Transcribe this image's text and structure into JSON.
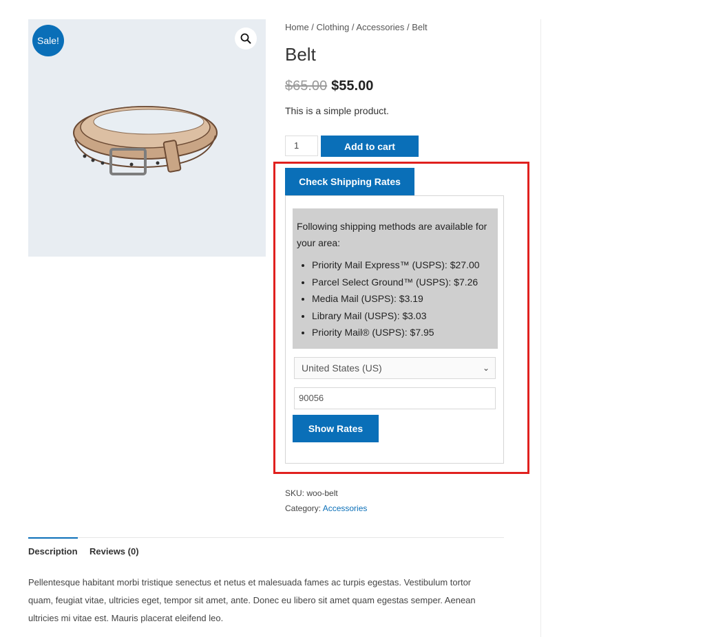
{
  "gallery": {
    "sale_badge": "Sale!",
    "zoom_icon": "search-icon",
    "image_alt": "belt"
  },
  "breadcrumb": "Home / Clothing / Accessories / Belt",
  "product": {
    "title": "Belt",
    "old_price": "$65.00",
    "new_price": "$55.00",
    "short_description": "This is a simple product.",
    "quantity": "1",
    "add_to_cart_label": "Add to cart"
  },
  "shipping": {
    "check_button": "Check Shipping Rates",
    "intro": "Following shipping methods are available for your area:",
    "methods": [
      "Priority Mail Express™ (USPS): $27.00",
      "Parcel Select Ground™ (USPS): $7.26",
      "Media Mail (USPS): $3.19",
      "Library Mail (USPS): $3.03",
      "Priority Mail® (USPS): $7.95"
    ],
    "country_value": "United States (US)",
    "zip_value": "90056",
    "show_rates_label": "Show Rates"
  },
  "meta": {
    "sku_label": "SKU:",
    "sku_value": "woo-belt",
    "category_label": "Category:",
    "category_value": "Accessories"
  },
  "tabs": {
    "description": "Description",
    "reviews": "Reviews (0)"
  },
  "description_text": "Pellentesque habitant morbi tristique senectus et netus et malesuada fames ac turpis egestas. Vestibulum tortor quam, feugiat vitae, ultricies eget, tempor sit amet, ante. Donec eu libero sit amet quam egestas semper. Aenean ultricies mi vitae est. Mauris placerat eleifend leo.",
  "colors": {
    "accent": "#0a6fb8",
    "highlight": "#e0201e",
    "rates_bg": "#cfcfcf"
  }
}
